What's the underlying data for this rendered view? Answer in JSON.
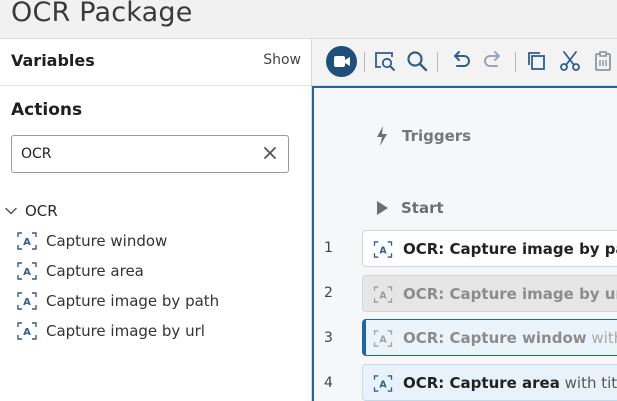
{
  "window": {
    "title": "OCR Package"
  },
  "variables": {
    "title": "Variables",
    "show_label": "Show"
  },
  "actions": {
    "title": "Actions",
    "search": {
      "value": "OCR",
      "placeholder": ""
    },
    "group": {
      "label": "OCR",
      "expanded": true
    },
    "items": [
      {
        "label": "Capture window",
        "icon": "ocr-action-icon"
      },
      {
        "label": "Capture area",
        "icon": "ocr-action-icon"
      },
      {
        "label": "Capture image by path",
        "icon": "ocr-action-icon"
      },
      {
        "label": "Capture image by url",
        "icon": "ocr-action-icon"
      }
    ]
  },
  "toolbar": {
    "icons": [
      "record-icon",
      "find-in-flow-icon",
      "search-icon",
      "undo-icon",
      "redo-icon",
      "copy-icon",
      "cut-icon",
      "paste-icon"
    ]
  },
  "flow": {
    "triggers_label": "Triggers",
    "start_label": "Start",
    "steps": [
      {
        "line": "1",
        "name": "OCR: Capture image by path",
        "suffix": "",
        "state": "normal"
      },
      {
        "line": "2",
        "name": "OCR: Capture image by url",
        "suffix": "",
        "state": "disabled"
      },
      {
        "line": "3",
        "name": "OCR: Capture window",
        "suffix": " with t",
        "state": "selected"
      },
      {
        "line": "4",
        "name": "OCR: Capture area",
        "suffix": " with title",
        "state": "highlighted"
      }
    ]
  },
  "colors": {
    "accent": "#1e64a8",
    "record_button": "#1f4f7a",
    "icon_blue": "#2f5f8f"
  }
}
